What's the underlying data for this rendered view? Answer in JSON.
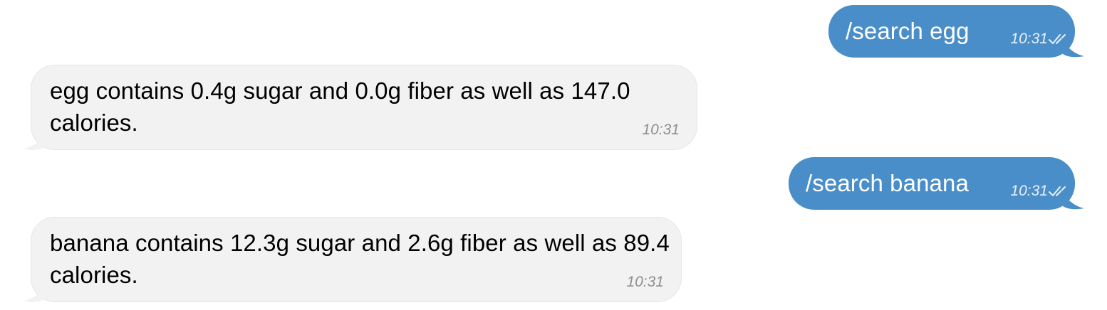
{
  "colors": {
    "outgoing_bubble": "#4a8ec9",
    "incoming_bubble": "#f2f2f2",
    "outgoing_text": "#ffffff",
    "incoming_text": "#000000",
    "timestamp_incoming": "#8e8e93"
  },
  "messages": [
    {
      "direction": "outgoing",
      "text": "/search egg",
      "time": "10:31",
      "status_icon": "double-check-icon"
    },
    {
      "direction": "incoming",
      "text": "egg contains 0.4g sugar and 0.0g fiber as well as 147.0 calories.",
      "time": "10:31"
    },
    {
      "direction": "outgoing",
      "text": "/search banana",
      "time": "10:31",
      "status_icon": "double-check-icon"
    },
    {
      "direction": "incoming",
      "text": "banana contains 12.3g sugar and 2.6g fiber as well as 89.4 calories.",
      "time": "10:31"
    }
  ]
}
